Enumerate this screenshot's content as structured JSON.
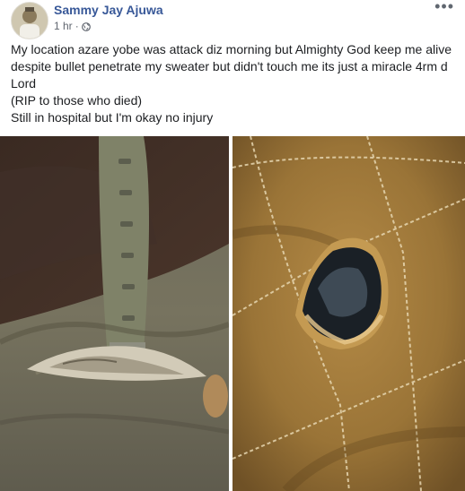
{
  "post": {
    "author": "Sammy Jay Ajuwa",
    "time": "1 hr",
    "separator": "·",
    "privacy_icon": "globe-icon",
    "more_icon": "more-options-icon",
    "more_glyph": "•••",
    "lines": [
      "My location azare yobe was attack diz morning but Almighty God keep me alive despite bullet penetrate my sweater but didn't touch me its just a miracle 4rm d Lord",
      "(RIP to those who died)",
      "Still in hospital but I'm okay no injury"
    ],
    "photos": [
      {
        "subject": "arm with wristwatch over torn grey fabric"
      },
      {
        "subject": "quilted brown jacket with bullet hole"
      }
    ]
  },
  "colors": {
    "author": "#385898",
    "meta": "#616770",
    "text": "#1c1e21"
  }
}
